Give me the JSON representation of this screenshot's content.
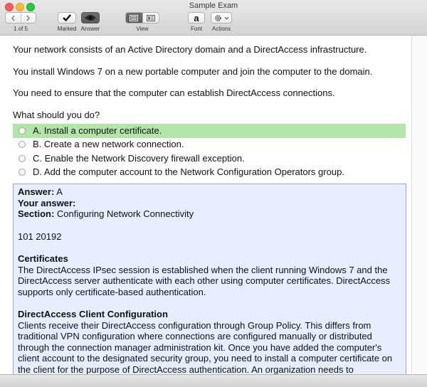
{
  "window": {
    "title": "Sample Exam"
  },
  "toolbar": {
    "prev_icon": "chevron-left-icon",
    "next_icon": "chevron-right-icon",
    "page_count": "1 of 5",
    "marked_label": "Marked",
    "answer_label": "Answer",
    "view_label": "View",
    "font_label": "Font",
    "font_glyph": "a",
    "actions_label": "Actions"
  },
  "question": {
    "paragraphs": [
      "Your network consists of an Active Directory domain and a DirectAccess infrastructure.",
      "You install Windows 7 on a new portable computer and join the computer to the domain.",
      "You need to ensure that the computer can establish DirectAccess connections.",
      "What should you do?"
    ],
    "choices": [
      {
        "text": "A. Install a computer certificate.",
        "correct": true
      },
      {
        "text": "B. Create a new network connection.",
        "correct": false
      },
      {
        "text": "C. Enable the Network Discovery firewall exception.",
        "correct": false
      },
      {
        "text": "D. Add the computer account to the Network Configuration Operators group.",
        "correct": false
      }
    ]
  },
  "answer_panel": {
    "answer_label": "Answer:",
    "answer_value": " A",
    "your_answer_label": "Your answer:",
    "section_label": "Section:",
    "section_value": " Configuring Network Connectivity",
    "ref_number": "101 20192",
    "heading1": "Certificates",
    "body1": "The DirectAccess IPsec session is established when the client running Windows 7 and the DirectAccess server authenticate with each other using computer certificates. DirectAccess supports only certificate-based authentication.",
    "heading2": "DirectAccess Client Configuration",
    "body2": "Clients receive their DirectAccess configuration through Group Policy. This differs from traditional VPN configuration where connections are configured manually or distributed through the connection manager administration kit. Once you have added the computer's client account to the designated security group, you need to install a computer certificate on the client for the purpose of DirectAccess authentication. An organization needs to"
  },
  "colors": {
    "correct_highlight": "#b2e6a8",
    "answer_bg": "#e7eeff"
  }
}
